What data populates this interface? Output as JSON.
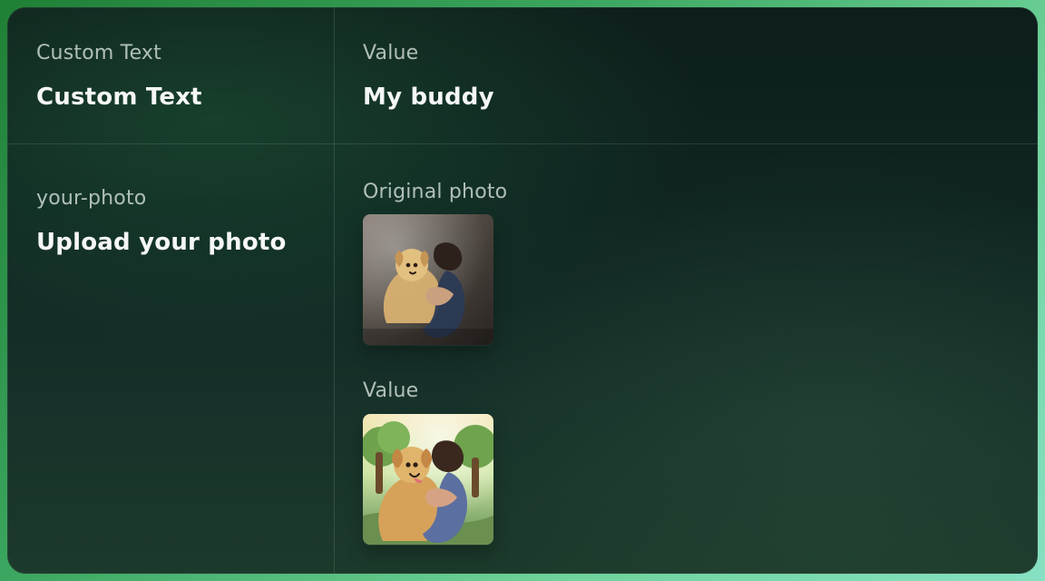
{
  "rows": [
    {
      "left": {
        "label": "Custom Text",
        "title": "Custom Text"
      },
      "right": {
        "label": "Value",
        "value": "My buddy"
      }
    },
    {
      "left": {
        "label": "your-photo",
        "title": "Upload your photo"
      },
      "right": {
        "original_label": "Original photo",
        "value_label": "Value",
        "original_image": {
          "icon": "photo-thumbnail-icon"
        },
        "value_image": {
          "icon": "photo-thumbnail-icon"
        }
      }
    }
  ]
}
